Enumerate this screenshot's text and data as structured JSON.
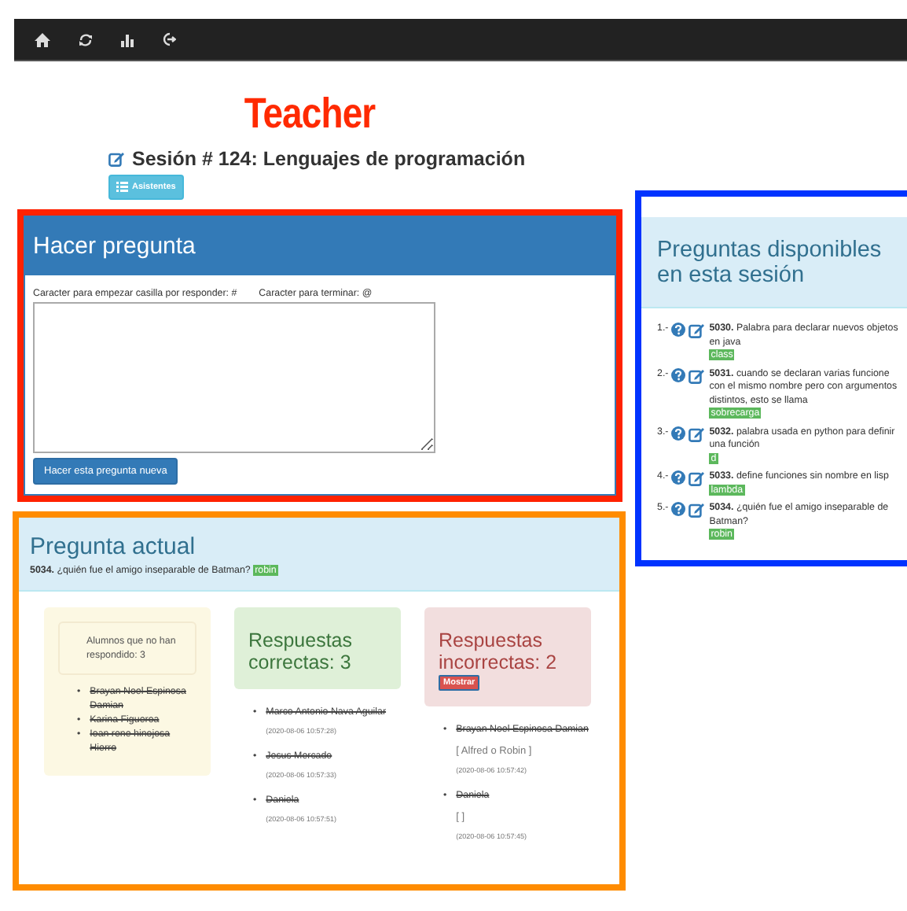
{
  "brand": "Teacher",
  "session": {
    "title": "Sesión # 124: Lenguajes de programación",
    "button": "Asistentes"
  },
  "ask": {
    "title": "Hacer pregunta",
    "hint_start": "Caracter para empezar casilla por responder: #",
    "hint_end": "Caracter para terminar: @",
    "button": "Hacer esta pregunta nueva"
  },
  "available": {
    "title": "Preguntas disponibles en esta sesión",
    "questions": [
      {
        "number": "1.-",
        "text": "**5030.** Palabra para declarar nuevos objetos en java",
        "answer": "class"
      },
      {
        "number": "2.-",
        "text": "**5031.** cuando se declaran varias funcione con el mismo nombre pero con argumentos distintos, esto se llama",
        "answer": "sobrecarga"
      },
      {
        "number": "3.-",
        "text": "**5032.** palabra usada en python para definir una función",
        "answer": "d"
      },
      {
        "number": "4.-",
        "text": "**5033.** define funciones sin nombre en lisp",
        "answer": "lambda"
      },
      {
        "number": "5.-",
        "text": "**5034.** ¿quién fue el amigo inseparable de Batman?",
        "answer": "robin"
      }
    ]
  },
  "current": {
    "title": "Pregunta actual",
    "question": "**5034.** ¿quién fue el amigo inseparable de Batman?",
    "answer": "robin",
    "pending": {
      "label": "Alumnos que no han respondido: 3",
      "students": [
        {
          "bullet": "•",
          "name": "Brayan Noel Espinosa Damian",
          "crossed_out": true
        },
        {
          "bullet": "•",
          "name": "Karina Figueroa",
          "crossed_out": true
        },
        {
          "bullet": "•",
          "name": "Ioan rene hinojosa Hierro",
          "crossed_out": true
        }
      ]
    },
    "correct": {
      "title": "Respuestas correctas: 3",
      "answers": [
        {
          "bullet": "•",
          "name": "Marco Antonio Nava Aguilar",
          "crossed_out": true,
          "time": "(2020-08-06 10:57:28)"
        },
        {
          "bullet": "•",
          "name": "Jesus Mercado",
          "crossed_out": true,
          "time": "(2020-08-06 10:57:33)"
        },
        {
          "bullet": "•",
          "name": "Daniela",
          "crossed_out": true,
          "time": "(2020-08-06 10:57:51)"
        }
      ]
    },
    "incorrect": {
      "title": "Respuestas incorrectas: 2",
      "button": "Mostrar",
      "answers": [
        {
          "bullet": "•",
          "name": "Brayan Noel Espinosa Damian",
          "crossed_out": true,
          "response": "[ Alfred o Robin ]",
          "time": "(2020-08-06 10:57:42)"
        },
        {
          "bullet": "•",
          "name": "Daniela",
          "crossed_out": true,
          "response": "[ ]",
          "time": "(2020-08-06 10:57:45)"
        }
      ]
    }
  }
}
